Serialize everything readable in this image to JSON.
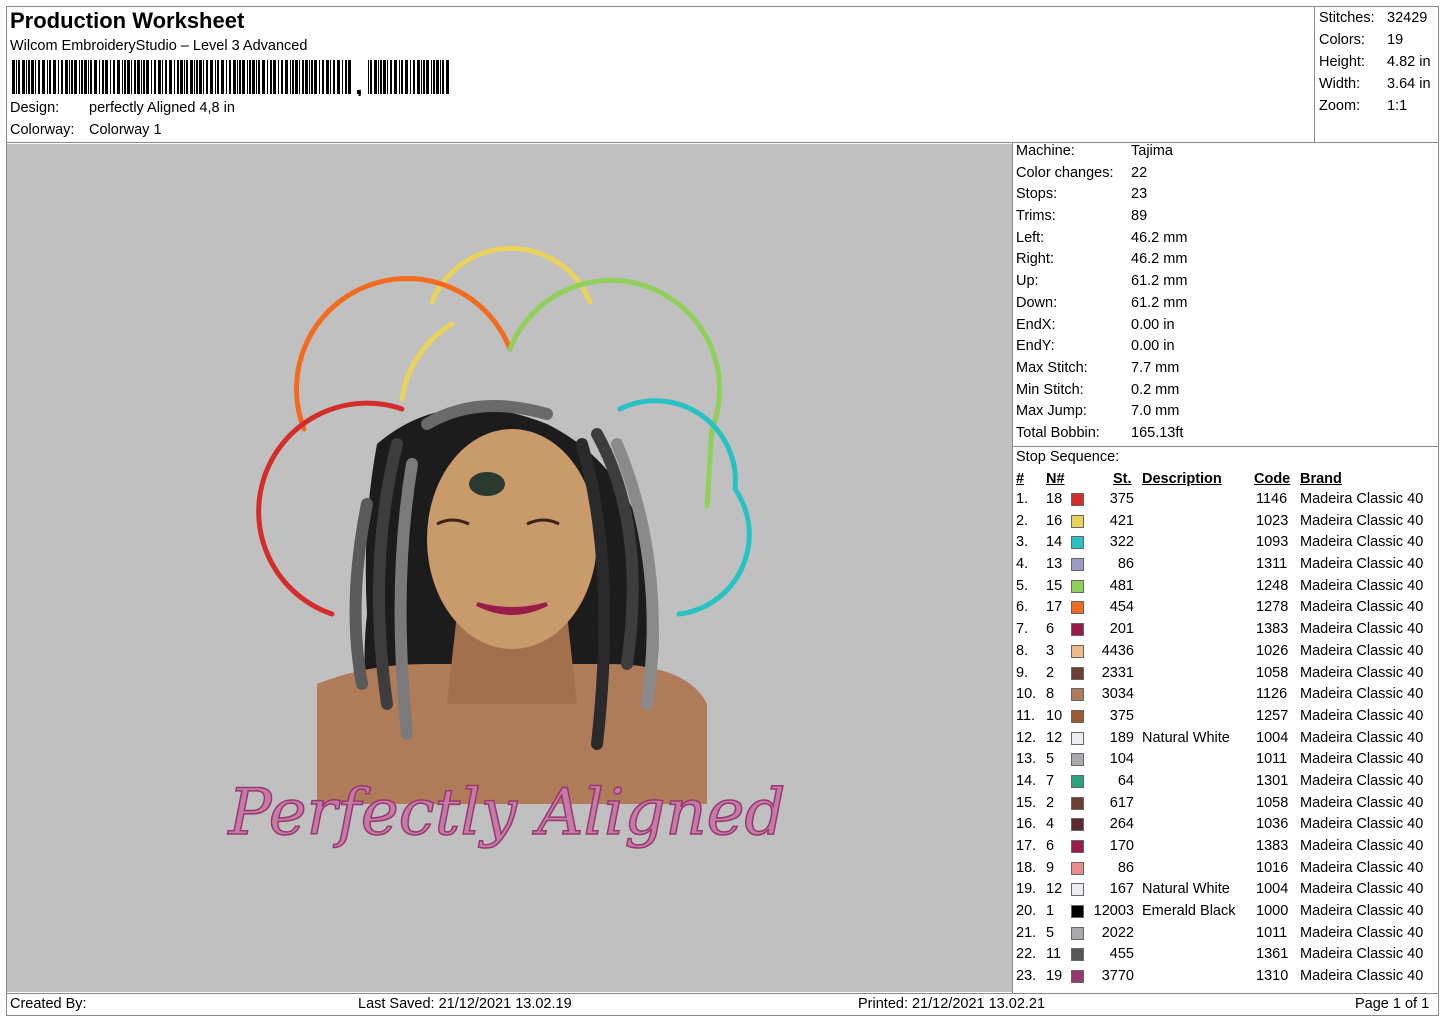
{
  "header": {
    "title": "Production Worksheet",
    "software": "Wilcom EmbroideryStudio – Level 3 Advanced",
    "design_label": "Design:",
    "design_value": "perfectly Aligned 4,8 in",
    "colorway_label": "Colorway:",
    "colorway_value": "Colorway 1"
  },
  "summary": [
    {
      "label": "Stitches:",
      "value": "32429"
    },
    {
      "label": "Colors:",
      "value": "19"
    },
    {
      "label": "Height:",
      "value": "4.82 in"
    },
    {
      "label": "Width:",
      "value": "3.64 in"
    },
    {
      "label": "Zoom:",
      "value": "1:1"
    }
  ],
  "machine_info": [
    {
      "label": "Machine:",
      "value": "Tajima"
    },
    {
      "label": "Color changes:",
      "value": "22"
    },
    {
      "label": "Stops:",
      "value": "23"
    },
    {
      "label": "Trims:",
      "value": "89"
    },
    {
      "label": "Left:",
      "value": "46.2 mm"
    },
    {
      "label": "Right:",
      "value": "46.2 mm"
    },
    {
      "label": "Up:",
      "value": "61.2 mm"
    },
    {
      "label": "Down:",
      "value": "61.2 mm"
    },
    {
      "label": "EndX:",
      "value": "0.00 in"
    },
    {
      "label": "EndY:",
      "value": "0.00 in"
    },
    {
      "label": "Max Stitch:",
      "value": "7.7 mm"
    },
    {
      "label": "Min Stitch:",
      "value": "0.2 mm"
    },
    {
      "label": "Max Jump:",
      "value": "7.0 mm"
    },
    {
      "label": "Total Bobbin:",
      "value": "165.13ft"
    }
  ],
  "stop_sequence": {
    "title": "Stop Sequence:",
    "columns": {
      "num": "#",
      "n": "N#",
      "st": "St.",
      "desc": "Description",
      "code": "Code",
      "brand": "Brand"
    },
    "rows": [
      {
        "num": "1.",
        "n": "18",
        "color": "#d42b2b",
        "st": "375",
        "desc": "",
        "code": "1146",
        "brand": "Madeira Classic 40"
      },
      {
        "num": "2.",
        "n": "16",
        "color": "#e9d35a",
        "st": "421",
        "desc": "",
        "code": "1023",
        "brand": "Madeira Classic 40"
      },
      {
        "num": "3.",
        "n": "14",
        "color": "#27c2c4",
        "st": "322",
        "desc": "",
        "code": "1093",
        "brand": "Madeira Classic 40"
      },
      {
        "num": "4.",
        "n": "13",
        "color": "#9b9bc8",
        "st": "86",
        "desc": "",
        "code": "1311",
        "brand": "Madeira Classic 40"
      },
      {
        "num": "5.",
        "n": "15",
        "color": "#8fcf5a",
        "st": "481",
        "desc": "",
        "code": "1248",
        "brand": "Madeira Classic 40"
      },
      {
        "num": "6.",
        "n": "17",
        "color": "#f26b1f",
        "st": "454",
        "desc": "",
        "code": "1278",
        "brand": "Madeira Classic 40"
      },
      {
        "num": "7.",
        "n": "6",
        "color": "#9b1b4b",
        "st": "201",
        "desc": "",
        "code": "1383",
        "brand": "Madeira Classic 40"
      },
      {
        "num": "8.",
        "n": "3",
        "color": "#f0b98c",
        "st": "4436",
        "desc": "",
        "code": "1026",
        "brand": "Madeira Classic 40"
      },
      {
        "num": "9.",
        "n": "2",
        "color": "#6d3f33",
        "st": "2331",
        "desc": "",
        "code": "1058",
        "brand": "Madeira Classic 40"
      },
      {
        "num": "10.",
        "n": "8",
        "color": "#b07b58",
        "st": "3034",
        "desc": "",
        "code": "1126",
        "brand": "Madeira Classic 40"
      },
      {
        "num": "11.",
        "n": "10",
        "color": "#9e5a2e",
        "st": "375",
        "desc": "",
        "code": "1257",
        "brand": "Madeira Classic 40"
      },
      {
        "num": "12.",
        "n": "12",
        "color": "#ececf2",
        "st": "189",
        "desc": "Natural White",
        "code": "1004",
        "brand": "Madeira Classic 40"
      },
      {
        "num": "13.",
        "n": "5",
        "color": "#a8aaad",
        "st": "104",
        "desc": "",
        "code": "1011",
        "brand": "Madeira Classic 40"
      },
      {
        "num": "14.",
        "n": "7",
        "color": "#2aa37a",
        "st": "64",
        "desc": "",
        "code": "1301",
        "brand": "Madeira Classic 40"
      },
      {
        "num": "15.",
        "n": "2",
        "color": "#6d3f33",
        "st": "617",
        "desc": "",
        "code": "1058",
        "brand": "Madeira Classic 40"
      },
      {
        "num": "16.",
        "n": "4",
        "color": "#5b2a2a",
        "st": "264",
        "desc": "",
        "code": "1036",
        "brand": "Madeira Classic 40"
      },
      {
        "num": "17.",
        "n": "6",
        "color": "#9b1b4b",
        "st": "170",
        "desc": "",
        "code": "1383",
        "brand": "Madeira Classic 40"
      },
      {
        "num": "18.",
        "n": "9",
        "color": "#e98c8c",
        "st": "86",
        "desc": "",
        "code": "1016",
        "brand": "Madeira Classic 40"
      },
      {
        "num": "19.",
        "n": "12",
        "color": "#ececf2",
        "st": "167",
        "desc": "Natural White",
        "code": "1004",
        "brand": "Madeira Classic 40"
      },
      {
        "num": "20.",
        "n": "1",
        "color": "#000000",
        "st": "12003",
        "desc": "Emerald Black",
        "code": "1000",
        "brand": "Madeira Classic 40"
      },
      {
        "num": "21.",
        "n": "5",
        "color": "#a8aaad",
        "st": "2022",
        "desc": "",
        "code": "1011",
        "brand": "Madeira Classic 40"
      },
      {
        "num": "22.",
        "n": "11",
        "color": "#575757",
        "st": "455",
        "desc": "",
        "code": "1361",
        "brand": "Madeira Classic 40"
      },
      {
        "num": "23.",
        "n": "19",
        "color": "#97386f",
        "st": "3770",
        "desc": "",
        "code": "1310",
        "brand": "Madeira Classic 40"
      }
    ]
  },
  "design_text": "Perfectly Aligned",
  "footer": {
    "created_by": "Created By:",
    "last_saved": "Last Saved: 21/12/2021 13.02.19",
    "printed": "Printed: 21/12/2021 13.02.21",
    "page": "Page 1 of 1"
  }
}
